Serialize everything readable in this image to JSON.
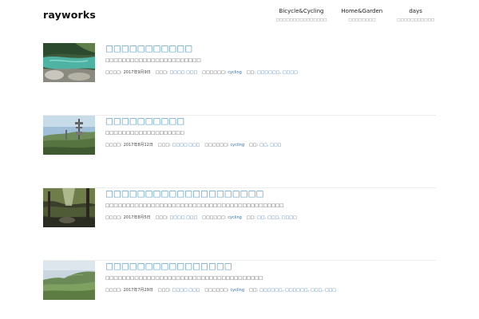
{
  "site": {
    "title": "rayworks"
  },
  "nav": [
    {
      "label": "Bicycle&Cycling",
      "sub": "□□□□□□□□□□□□□□□"
    },
    {
      "label": "Home&Garden",
      "sub": "□□□□□□□□"
    },
    {
      "label": "days",
      "sub": "□□□□□□□□□□□"
    }
  ],
  "posts": [
    {
      "title": "□□□□□□□□□□□",
      "excerpt": "□□□□□□□□□□□□□□□□□□□□□□□",
      "date_label": "□□□□:",
      "date": "2017年9月9日",
      "author_label": "□□□:",
      "author": "□□□□ □□□",
      "category_label": "□□□□□□:",
      "category": "cycling",
      "tags_label": "□□:",
      "tags": [
        "□□□□□□",
        "□□□□"
      ],
      "thumb_alt": "river thumbnail"
    },
    {
      "title": "□□□□□□□□□□",
      "excerpt": "□□□□□□□□□□□□□□□□□□□",
      "date_label": "□□□□:",
      "date": "2017年8月12日",
      "author_label": "□□□:",
      "author": "□□□□ □□□",
      "category_label": "□□□□□□:",
      "category": "cycling",
      "tags_label": "□□:",
      "tags": [
        "□□",
        "□□□"
      ],
      "thumb_alt": "mountain tower thumbnail"
    },
    {
      "title": "□□□□□□□□□□□□□□□□□□□□",
      "excerpt": "□□□□□□□□□□□□□□□□□□□□□□□□□□□□□□□□□□□□□□□□□□□",
      "date_label": "□□□□:",
      "date": "2017年8月5日",
      "author_label": "□□□:",
      "author": "□□□□ □□□",
      "category_label": "□□□□□□:",
      "category": "cycling",
      "tags_label": "□□:",
      "tags": [
        "□□",
        "□□□",
        "□□□□"
      ],
      "thumb_alt": "forest thumbnail"
    },
    {
      "title": "□□□□□□□□□□□□□□□□",
      "excerpt": "□□□□□□□□□□□□□□□□□□□□□□□□□□□□□□□□□□□□□□",
      "date_label": "□□□□:",
      "date": "2017年7月29日",
      "author_label": "□□□:",
      "author": "□□□□ □□□",
      "category_label": "□□□□□□:",
      "category": "cycling",
      "tags_label": "□□:",
      "tags": [
        "□□□□□□",
        "□□□□□□",
        "□□□",
        "□□□"
      ],
      "thumb_alt": "grassland thumbnail"
    }
  ]
}
